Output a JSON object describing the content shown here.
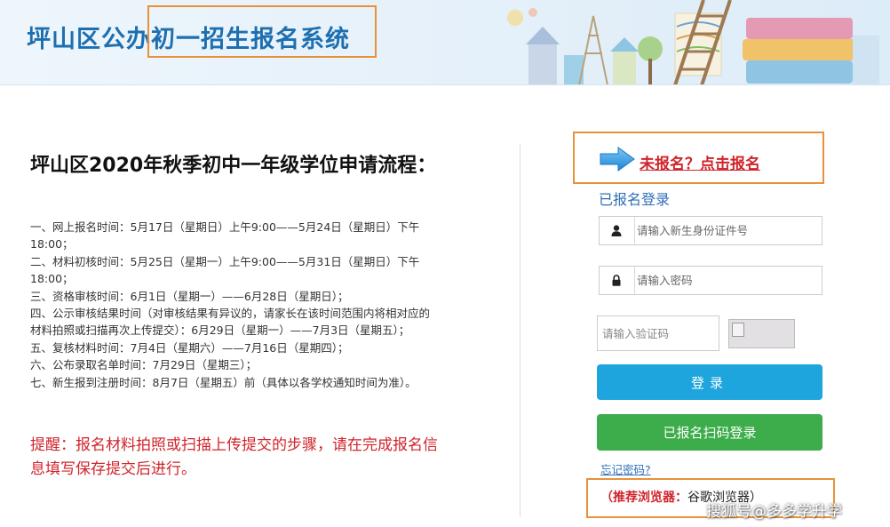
{
  "header": {
    "title": "坪山区公办初一招生报名系统"
  },
  "main": {
    "process_title": "坪山区2020年秋季初中一年级学位申请流程：",
    "steps": [
      "一、网上报名时间：5月17日（星期日）上午9:00——5月24日（星期日）下午18:00；",
      "二、材料初核时间：5月25日（星期一）上午9:00——5月31日（星期日）下午18:00；",
      "三、资格审核时间：6月1日（星期一）——6月28日（星期日）；",
      "四、公示审核结果时间（对审核结果有异议的，请家长在该时间范围内将相对应的材料拍照或扫描再次上传提交）：6月29日（星期一）——7月3日（星期五）；",
      "五、复核材料时间：7月4日（星期六）——7月16日（星期四）；",
      "六、公布录取名单时间：7月29日（星期三）；",
      "七、新生报到注册时间：8月7日（星期五）前（具体以各学校通知时间为准）。"
    ],
    "reminder": "提醒：报名材料拍照或扫描上传提交的步骤，请在完成报名信息填写保存提交后进行。"
  },
  "login": {
    "register_link": "未报名？点击报名",
    "heading": "已报名登录",
    "id_placeholder": "请输入新生身份证件号",
    "password_placeholder": "请输入密码",
    "captcha_placeholder": "请输入验证码",
    "login_button": "登录",
    "scan_button": "已报名扫码登录",
    "forgot_password": "忘记密码?",
    "browser_tip_label": "（推荐浏览器：",
    "browser_tip_value": "谷歌浏览器）"
  },
  "watermark": "搜狐号@多多学升学",
  "colors": {
    "title_blue": "#1d6fb0",
    "accent_red": "#d0242b",
    "highlight_orange": "#e8913a",
    "login_blue": "#1fa5dd",
    "scan_green": "#3cad4a"
  },
  "icons": [
    "user-icon",
    "lock-icon",
    "arrow-right-icon",
    "broken-image-icon"
  ]
}
